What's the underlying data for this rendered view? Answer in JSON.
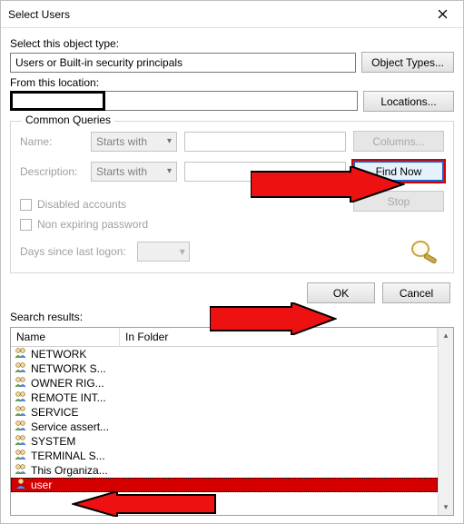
{
  "window": {
    "title": "Select Users"
  },
  "objectType": {
    "label": "Select this object type:",
    "value": "Users or Built-in security principals",
    "button": "Object Types..."
  },
  "location": {
    "label": "From this location:",
    "value": "",
    "button": "Locations..."
  },
  "queries": {
    "legend": "Common Queries",
    "nameLabel": "Name:",
    "nameMode": "Starts with",
    "descLabel": "Description:",
    "descMode": "Starts with",
    "disabled": "Disabled accounts",
    "nonexp": "Non expiring password",
    "daysLabel": "Days since last logon:",
    "columns": "Columns...",
    "findNow": "Find Now",
    "stop": "Stop"
  },
  "buttons": {
    "ok": "OK",
    "cancel": "Cancel"
  },
  "results": {
    "label": "Search results:",
    "cols": {
      "name": "Name",
      "folder": "In Folder"
    },
    "items": [
      "NETWORK",
      "NETWORK S...",
      "OWNER RIG...",
      "REMOTE INT...",
      "SERVICE",
      "Service assert...",
      "SYSTEM",
      "TERMINAL S...",
      "This Organiza...",
      "user"
    ]
  }
}
